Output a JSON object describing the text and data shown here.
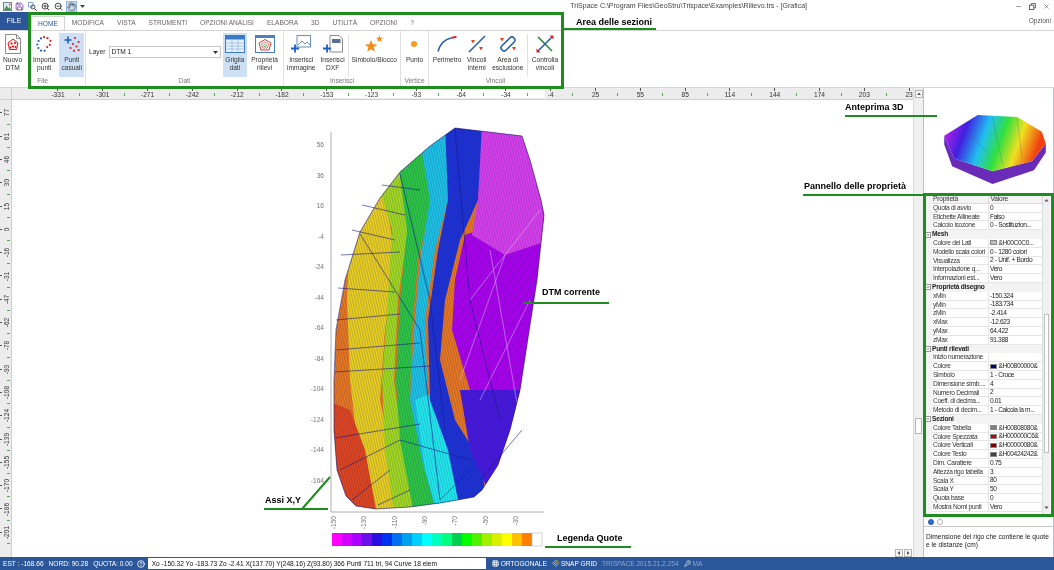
{
  "title_bar": {
    "title": "TriSpace C:\\Program Files\\GeoStru\\Trispace\\Examples\\Rilievo.trs - [Grafica]",
    "quick_access": [
      {
        "selected": false
      },
      {
        "selected": false
      },
      {
        "selected": false
      },
      {
        "selected": false
      },
      {
        "selected": true
      }
    ]
  },
  "menu": {
    "file_button": "FILE",
    "tabs": [
      {
        "label": "HOME",
        "selected": true
      },
      {
        "label": "MODIFICA",
        "selected": false
      },
      {
        "label": "VISTA",
        "selected": false
      },
      {
        "label": "STRUMENTI",
        "selected": false
      },
      {
        "label": "OPZIONI ANALISI",
        "selected": false
      },
      {
        "label": "ELABORA",
        "selected": false
      },
      {
        "label": "3D",
        "selected": false
      },
      {
        "label": "UTILITÀ",
        "selected": false
      },
      {
        "label": "OPZIONI",
        "selected": false
      },
      {
        "label": "?",
        "selected": false
      }
    ],
    "options_link": "Opzioni"
  },
  "ribbon": {
    "groups": [
      {
        "label": "File",
        "items": [
          {
            "kind": "button",
            "label": "Nuovo\nDTM",
            "selected": false
          },
          {
            "kind": "button",
            "label": "Importa\npunti",
            "selected": false
          },
          {
            "kind": "button",
            "label": "Punti\ncasuali",
            "selected": true
          }
        ]
      },
      {
        "label": "Dati",
        "items": [
          {
            "kind": "dropdown",
            "label": "Layer",
            "value": "DTM 1"
          },
          {
            "kind": "button",
            "label": "Griglia\ndati",
            "selected": true
          },
          {
            "kind": "button",
            "label": "Proprietà\nrilievi",
            "selected": false
          }
        ]
      },
      {
        "label": "Inserisci",
        "items": [
          {
            "kind": "button",
            "label": "Inserisci\nimmagine",
            "selected": false
          },
          {
            "kind": "button",
            "label": "Inserisci\nDXF",
            "selected": false
          },
          {
            "kind": "separator"
          },
          {
            "kind": "button",
            "label": "Simbolo/Blocco",
            "selected": false
          }
        ]
      },
      {
        "label": "Vertice",
        "items": [
          {
            "kind": "button",
            "label": "Punto",
            "selected": false
          }
        ]
      },
      {
        "label": "Vincoli",
        "items": [
          {
            "kind": "button",
            "label": "Perimetro",
            "selected": false
          },
          {
            "kind": "button",
            "label": "Vincoli\ninterni",
            "selected": false
          },
          {
            "kind": "button",
            "label": "Area di\nesclusione",
            "selected": false
          },
          {
            "kind": "separator"
          },
          {
            "kind": "button",
            "label": "Controlla\nvincoli",
            "selected": false
          }
        ]
      }
    ]
  },
  "canvas": {
    "top_ruler": [
      "-331",
      "-301",
      "-271",
      "-242",
      "-212",
      "-182",
      "-153",
      "-123",
      "-93",
      "-64",
      "-34",
      "-4",
      "25",
      "55",
      "85",
      "114",
      "144",
      "174",
      "203",
      "23"
    ],
    "left_ruler": [
      "77",
      "61",
      "46",
      "30",
      "15",
      "0",
      "-16",
      "-31",
      "-47",
      "-62",
      "-78",
      "-93",
      "-108",
      "-124",
      "-139",
      "-155",
      "-170",
      "-186",
      "-201"
    ],
    "plot": {
      "y_ticks": [
        "56",
        "36",
        "16",
        "-4",
        "-24",
        "-44",
        "-64",
        "-84",
        "-104",
        "-124",
        "-144",
        "-164"
      ],
      "x_ticks": [
        "-150",
        "-130",
        "-110",
        "-90",
        "-70",
        "-50",
        "-30"
      ]
    },
    "legend": [
      {
        "color": "#ff00ff"
      },
      {
        "color": "#d400ff"
      },
      {
        "color": "#aa00ff"
      },
      {
        "color": "#6a10e8"
      },
      {
        "color": "#2a10e0"
      },
      {
        "color": "#0030f0"
      },
      {
        "color": "#0070f0"
      },
      {
        "color": "#00a0f0"
      },
      {
        "color": "#00d0ff"
      },
      {
        "color": "#00ffff"
      },
      {
        "color": "#00ffc0"
      },
      {
        "color": "#00ff80"
      },
      {
        "color": "#00d050"
      },
      {
        "color": "#00ff00"
      },
      {
        "color": "#50f000"
      },
      {
        "color": "#a0f000"
      },
      {
        "color": "#d8f000"
      },
      {
        "color": "#ffff00"
      },
      {
        "color": "#ffc000"
      },
      {
        "color": "#ff8000"
      },
      {
        "color": "#ffffff"
      }
    ]
  },
  "property_grid": {
    "columns": [
      "Proprietà",
      "Valore"
    ],
    "rows": [
      {
        "kind": "property",
        "name": "Quota di avvio",
        "value": "0"
      },
      {
        "kind": "property",
        "name": "Etichette Allineate",
        "value": "Falso"
      },
      {
        "kind": "property",
        "name": "Calcolo isozone",
        "value": "0 - Sostituzion..."
      },
      {
        "kind": "category",
        "name": "Mesh",
        "expanded": true
      },
      {
        "kind": "property",
        "name": "Colore dei Lati",
        "value": "&H00C0C0...",
        "color": "#c0c0c0"
      },
      {
        "kind": "property",
        "name": "Modello scala colori",
        "value": "0 - 1280 colori"
      },
      {
        "kind": "property",
        "name": "Visualizza",
        "value": "2 - Unif. + Bordo"
      },
      {
        "kind": "property",
        "name": "Interpolazione q...",
        "value": "Vero"
      },
      {
        "kind": "property",
        "name": "Informazioni est...",
        "value": "Vero"
      },
      {
        "kind": "category",
        "name": "Proprietà disegno",
        "expanded": true
      },
      {
        "kind": "property",
        "name": "xMin",
        "value": "-150.324"
      },
      {
        "kind": "property",
        "name": "yMin",
        "value": "-183.734"
      },
      {
        "kind": "property",
        "name": "zMin",
        "value": "-2.414"
      },
      {
        "kind": "property",
        "name": "xMax",
        "value": "-12.623"
      },
      {
        "kind": "property",
        "name": "yMax",
        "value": "64.422"
      },
      {
        "kind": "property",
        "name": "zMax",
        "value": "91.388"
      },
      {
        "kind": "category",
        "name": "Punti rilevati",
        "expanded": true
      },
      {
        "kind": "property",
        "name": "Inizio numerazione"
      },
      {
        "kind": "property",
        "name": "Colore",
        "value": "&H00800000&",
        "color": "#000080"
      },
      {
        "kind": "property",
        "name": "Simbolo",
        "value": "1 - Croce"
      },
      {
        "kind": "property",
        "name": "Dimensione simb....",
        "value": "4"
      },
      {
        "kind": "property",
        "name": "Numero Decimali",
        "value": "2"
      },
      {
        "kind": "property",
        "name": "Coeff. di decima...",
        "value": "0.01"
      },
      {
        "kind": "property",
        "name": "Metodo di decim...",
        "value": "1 - Calcola la m..."
      },
      {
        "kind": "category",
        "name": "Sezioni",
        "expanded": true
      },
      {
        "kind": "property",
        "name": "Colore Tabella",
        "value": "&H00808080&",
        "color": "#808080"
      },
      {
        "kind": "property",
        "name": "Colore Spezzata",
        "value": "&H000000C6&",
        "color": "#c60000"
      },
      {
        "kind": "property",
        "name": "Colore Verticali",
        "value": "&H00000080&",
        "color": "#800000"
      },
      {
        "kind": "property",
        "name": "Colore Testo",
        "value": "&H00424242&",
        "color": "#424242"
      },
      {
        "kind": "property",
        "name": "Dim. Carattere",
        "value": "0.75"
      },
      {
        "kind": "property",
        "name": "Altezza rigo tabella",
        "value": "3"
      },
      {
        "kind": "property",
        "name": "Scala X",
        "value": "80"
      },
      {
        "kind": "property",
        "name": "Scala Y",
        "value": "50"
      },
      {
        "kind": "property",
        "name": "Quota base",
        "value": "0"
      },
      {
        "kind": "property",
        "name": "Mostra Nomi punti",
        "value": "Vero"
      }
    ],
    "view_modes": [
      {
        "selected": true
      },
      {
        "selected": false
      }
    ],
    "description": "Dimensione del rigo che contiene le quote e le distanze (cm)"
  },
  "status_bar": {
    "coordinates": [
      "EST : -168.66",
      "NORD: 90.28",
      "QUOTA: 0.00"
    ],
    "info": "Xo -150.32 Yo -183.73 Zo -2.41 X(137.70) Y(248.16) Z(93.80) 366 Punti 711 tri, 94 Curve 18 elem",
    "modes": [
      {
        "label": "ORTOGONALE",
        "enabled": true
      },
      {
        "label": "SNAP GRID",
        "enabled": true
      },
      {
        "label": "TRISPACE 2015.21.2.254",
        "enabled": false
      },
      {
        "label": "MA",
        "enabled": false
      }
    ]
  },
  "annotations": [
    "Area delle sezioni",
    "Anteprima 3D",
    "Pannello delle proprietà",
    "DTM corrente",
    "Assi X,Y",
    "Legenda Quote"
  ]
}
